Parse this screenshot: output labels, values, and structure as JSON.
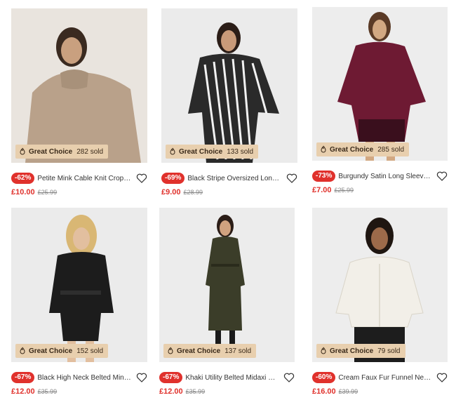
{
  "products": [
    {
      "discount": "-62%",
      "title": "Petite Mink Cable Knit Crop J...",
      "price": "£10.00",
      "was": "£25.99",
      "badge_label": "Great Choice",
      "sold": "282 sold",
      "bg": "#e9e4de",
      "garment": "#b9a18a"
    },
    {
      "discount": "-69%",
      "title": "Black Stripe Oversized Long S...",
      "price": "£9.00",
      "was": "£28.99",
      "badge_label": "Great Choice",
      "sold": "133 sold",
      "bg": "#ebebeb",
      "garment": "#2a2a2a"
    },
    {
      "discount": "-73%",
      "title": "Burgundy Satin Long Sleeve S...",
      "price": "£7.00",
      "was": "£25.99",
      "badge_label": "Great Choice",
      "sold": "285 sold",
      "bg": "#ededed",
      "garment": "#6e1a33"
    },
    {
      "discount": "-67%",
      "title": "Black High Neck Belted Mini ...",
      "price": "£12.00",
      "was": "£35.99",
      "badge_label": "Great Choice",
      "sold": "152 sold",
      "bg": "#ebebeb",
      "garment": "#1c1c1c"
    },
    {
      "discount": "-67%",
      "title": "Khaki Utility Belted Midaxi Shi...",
      "price": "£12.00",
      "was": "£35.99",
      "badge_label": "Great Choice",
      "sold": "137 sold",
      "bg": "#ececec",
      "garment": "#3b3d29"
    },
    {
      "discount": "-60%",
      "title": "Cream Faux Fur Funnel Neck ...",
      "price": "£16.00",
      "was": "£39.99",
      "badge_label": "Great Choice",
      "sold": "79 sold",
      "bg": "#ededed",
      "garment": "#f2efe8"
    }
  ],
  "colors": {
    "accent": "#e0312c",
    "badge_bg": "#e8cfae"
  }
}
